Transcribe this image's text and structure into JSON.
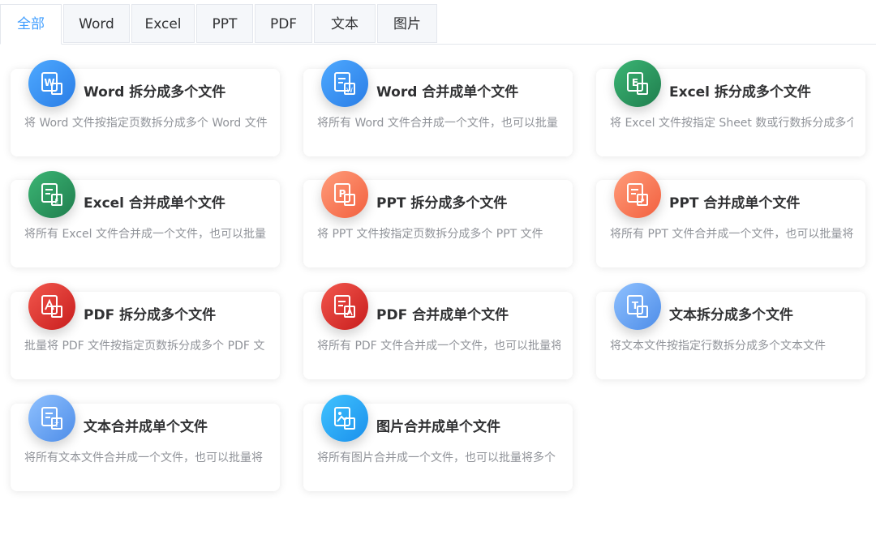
{
  "tabs": [
    {
      "label": "全部",
      "active": true
    },
    {
      "label": "Word"
    },
    {
      "label": "Excel"
    },
    {
      "label": "PPT"
    },
    {
      "label": "PDF"
    },
    {
      "label": "文本"
    },
    {
      "label": "图片"
    }
  ],
  "cards": [
    {
      "title": "Word 拆分成多个文件",
      "desc": "将 Word 文件按指定页数拆分成多个 Word 文件",
      "icon": "word-icon",
      "color": "blue"
    },
    {
      "title": "Word 合并成单个文件",
      "desc": "将所有 Word 文件合并成一个文件，也可以批量",
      "icon": "word-merge-icon",
      "color": "blue"
    },
    {
      "title": "Excel 拆分成多个文件",
      "desc": "将 Excel 文件按指定 Sheet 数或行数拆分成多个",
      "icon": "excel-icon",
      "color": "green"
    },
    {
      "title": "Excel 合并成单个文件",
      "desc": "将所有 Excel 文件合并成一个文件，也可以批量",
      "icon": "excel-merge-icon",
      "color": "green"
    },
    {
      "title": "PPT 拆分成多个文件",
      "desc": "将 PPT 文件按指定页数拆分成多个 PPT 文件",
      "icon": "ppt-icon",
      "color": "orange"
    },
    {
      "title": "PPT 合并成单个文件",
      "desc": "将所有 PPT 文件合并成一个文件，也可以批量将",
      "icon": "ppt-merge-icon",
      "color": "orange"
    },
    {
      "title": "PDF 拆分成多个文件",
      "desc": "批量将 PDF 文件按指定页数拆分成多个 PDF 文",
      "icon": "pdf-icon",
      "color": "red"
    },
    {
      "title": "PDF 合并成单个文件",
      "desc": "将所有 PDF 文件合并成一个文件，也可以批量将",
      "icon": "pdf-merge-icon",
      "color": "red"
    },
    {
      "title": "文本拆分成多个文件",
      "desc": "将文本文件按指定行数拆分成多个文本文件",
      "icon": "text-icon",
      "color": "lightblue"
    },
    {
      "title": "文本合并成单个文件",
      "desc": "将所有文本文件合并成一个文件，也可以批量将",
      "icon": "text-merge-icon",
      "color": "lightblue"
    },
    {
      "title": "图片合并成单个文件",
      "desc": "将所有图片合并成一个文件，也可以批量将多个",
      "icon": "image-merge-icon",
      "color": "cyan"
    }
  ]
}
